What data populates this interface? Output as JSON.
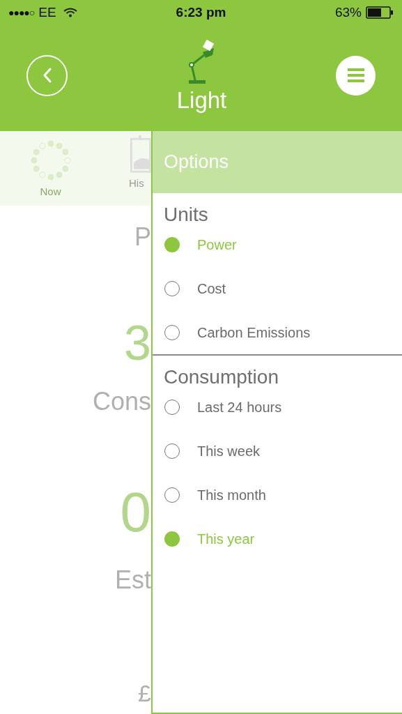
{
  "status_bar": {
    "signal": "●●●●○",
    "carrier": "EE",
    "time": "6:23 pm",
    "battery": "63%"
  },
  "header": {
    "title": "Light"
  },
  "background": {
    "tabs": [
      {
        "label": "Now",
        "selected": true
      },
      {
        "label": "His",
        "selected": false
      }
    ],
    "texts": [
      "P",
      "3",
      "Cons",
      "0",
      "Est",
      "£"
    ]
  },
  "options": {
    "title": "Options",
    "sections": [
      {
        "heading": "Units",
        "items": [
          {
            "label": "Power",
            "selected": true
          },
          {
            "label": "Cost",
            "selected": false
          },
          {
            "label": "Carbon Emissions",
            "selected": false
          }
        ]
      },
      {
        "heading": "Consumption",
        "items": [
          {
            "label": "Last 24 hours",
            "selected": false
          },
          {
            "label": "This week",
            "selected": false
          },
          {
            "label": "This month",
            "selected": false
          },
          {
            "label": "This year",
            "selected": true
          }
        ]
      }
    ]
  }
}
